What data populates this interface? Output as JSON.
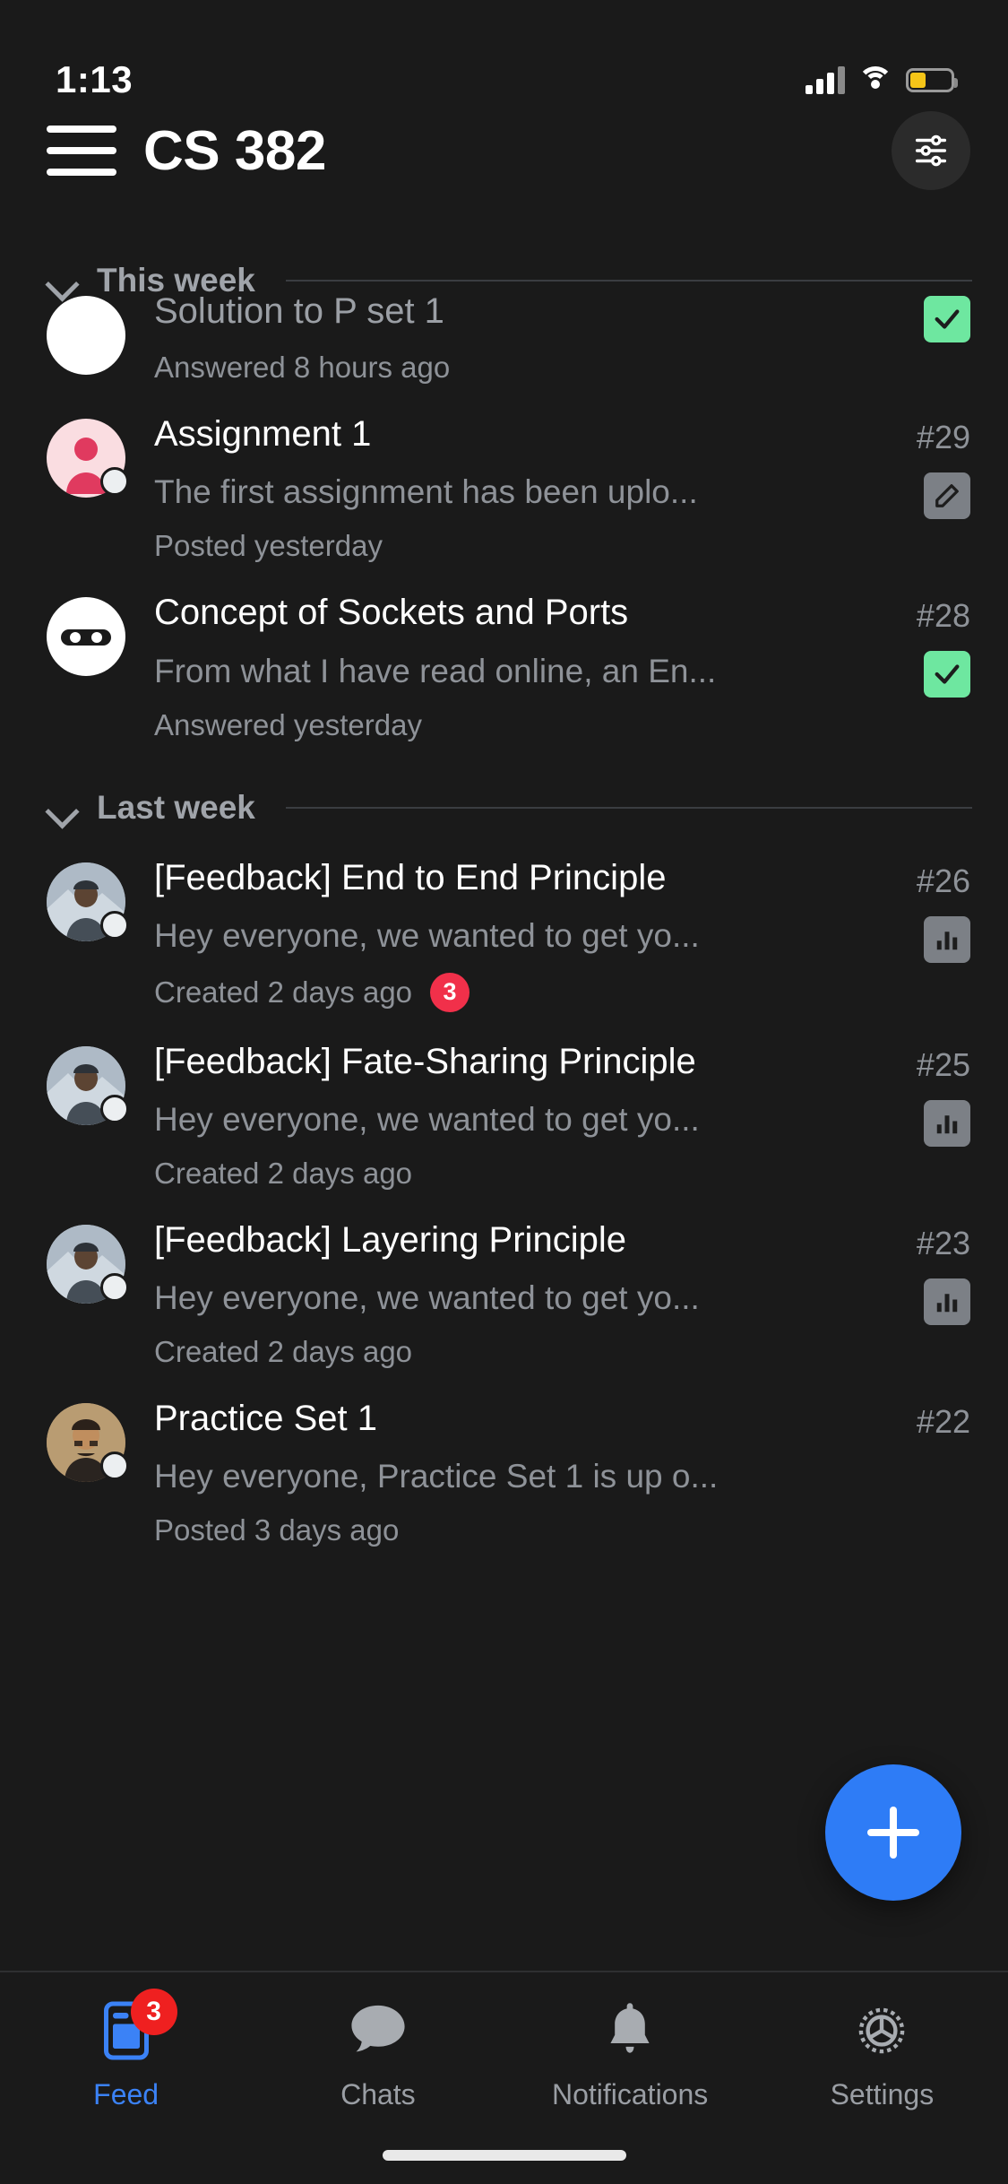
{
  "status_bar": {
    "time": "1:13",
    "signal_icon": "signal-bars-icon",
    "wifi_icon": "wifi-icon",
    "battery_icon": "battery-low-icon",
    "battery_color": "#f5c518"
  },
  "header": {
    "menu_icon": "hamburger-menu-icon",
    "title": "CS 382",
    "filter_icon": "sliders-filter-icon"
  },
  "sections": [
    {
      "label": "This week",
      "collapse_icon": "chevron-down-icon",
      "items": [
        {
          "title": "Solution to P set 1",
          "snippet": "",
          "meta": "Answered 8 hours ago",
          "post_number": "",
          "badge": "answered",
          "badge_icon": "check-icon",
          "unread": false,
          "avatar": "white-anonymous-avatar",
          "avatar_style": "av-white",
          "online_dot": false,
          "unread_count": ""
        },
        {
          "title": "Assignment 1",
          "snippet": "The first assignment has been uplo...",
          "meta": "Posted yesterday",
          "post_number": "#29",
          "badge": "edit",
          "badge_icon": "pencil-icon",
          "unread": true,
          "avatar": "pink-person-avatar",
          "avatar_style": "av-pink",
          "online_dot": true,
          "unread_count": ""
        },
        {
          "title": "Concept of Sockets and Ports",
          "snippet": "From what I have read online, an En...",
          "meta": "Answered yesterday",
          "post_number": "#28",
          "badge": "answered",
          "badge_icon": "check-icon",
          "unread": true,
          "avatar": "white-ninja-avatar",
          "avatar_style": "av-white",
          "online_dot": false,
          "unread_count": ""
        }
      ]
    },
    {
      "label": "Last week",
      "collapse_icon": "chevron-down-icon",
      "items": [
        {
          "title": "[Feedback] End to End Principle",
          "snippet": "Hey everyone, we wanted to get yo...",
          "meta": "Created 2 days ago",
          "post_number": "#26",
          "badge": "poll",
          "badge_icon": "bar-chart-icon",
          "unread": true,
          "avatar": "photo-avatar-winter",
          "avatar_style": "av-photo",
          "online_dot": true,
          "unread_count": "3"
        },
        {
          "title": "[Feedback] Fate-Sharing Principle",
          "snippet": "Hey everyone, we wanted to get yo...",
          "meta": "Created 2 days ago",
          "post_number": "#25",
          "badge": "poll",
          "badge_icon": "bar-chart-icon",
          "unread": true,
          "avatar": "photo-avatar-winter",
          "avatar_style": "av-photo",
          "online_dot": true,
          "unread_count": ""
        },
        {
          "title": "[Feedback] Layering Principle",
          "snippet": "Hey everyone, we wanted to get yo...",
          "meta": "Created 2 days ago",
          "post_number": "#23",
          "badge": "poll",
          "badge_icon": "bar-chart-icon",
          "unread": true,
          "avatar": "photo-avatar-winter",
          "avatar_style": "av-photo",
          "online_dot": true,
          "unread_count": ""
        },
        {
          "title": "Practice Set 1",
          "snippet": "Hey everyone, Practice Set 1 is up o...",
          "meta": "Posted 3 days ago",
          "post_number": "#22",
          "badge": "none",
          "badge_icon": "",
          "unread": true,
          "avatar": "photo-avatar-man-glasses",
          "avatar_style": "av-photo2",
          "online_dot": true,
          "unread_count": ""
        }
      ]
    }
  ],
  "fab": {
    "label": "+",
    "icon": "plus-icon",
    "color": "#2e7cf6"
  },
  "tabbar": {
    "items": [
      {
        "label": "Feed",
        "icon": "feed-icon",
        "active": true,
        "badge": "3"
      },
      {
        "label": "Chats",
        "icon": "chat-bubble-icon",
        "active": false,
        "badge": ""
      },
      {
        "label": "Notifications",
        "icon": "bell-icon",
        "active": false,
        "badge": ""
      },
      {
        "label": "Settings",
        "icon": "gear-icon",
        "active": false,
        "badge": ""
      }
    ],
    "active_color": "#3b82f6",
    "inactive_color": "#9a9ea4"
  },
  "home_indicator": "home-indicator"
}
